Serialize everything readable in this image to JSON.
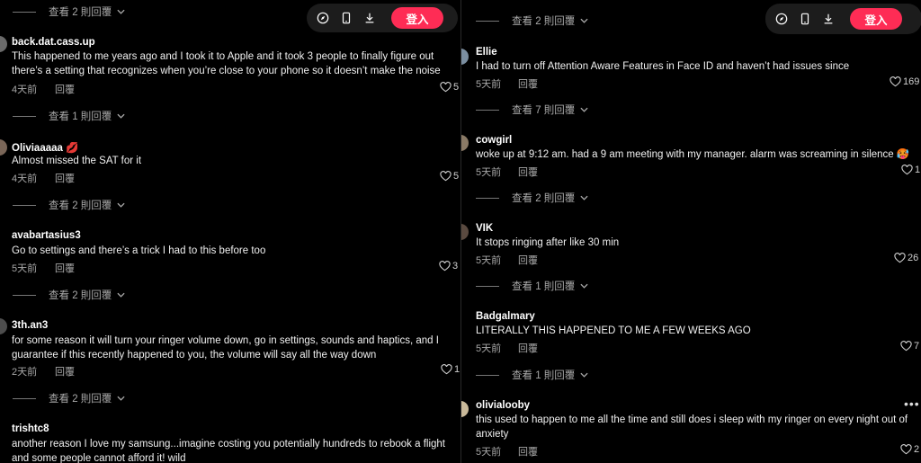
{
  "left": {
    "toolbar": {
      "login_label": "登入"
    },
    "top_view_more": "查看 2 則回覆",
    "comments": [
      {
        "user": "back.dat.cass.up",
        "lines": [
          "This happened to me years ago and I took it to Apple and it took 3 people to finally figure out",
          "there’s a setting that recognizes when you’re close to your phone so it doesn’t make the noise"
        ],
        "time": "4天前",
        "reply": "回覆",
        "likes": "5",
        "view_more": "查看 1 則回覆"
      },
      {
        "user": "Oliviaaaaa 💋",
        "lines": [
          "Almost missed the SAT for it"
        ],
        "time": "4天前",
        "reply": "回覆",
        "likes": "5",
        "view_more": "查看 2 則回覆"
      },
      {
        "user": "avabartasius3",
        "lines": [
          "Go to settings and there’s a trick I had to this before too"
        ],
        "time": "5天前",
        "reply": "回覆",
        "likes": "3",
        "view_more": "查看 2 則回覆"
      },
      {
        "user": "3th.an3",
        "lines": [
          "for some reason it will turn your ringer volume down, go in settings, sounds and haptics, and I",
          "guarantee if this recently happened to you, the volume will say all the way down"
        ],
        "time": "2天前",
        "reply": "回覆",
        "likes": "1",
        "view_more": "查看 2 則回覆"
      },
      {
        "user": "trishtc8",
        "lines": [
          "another reason I love my samsung...imagine costing you potentially hundreds to rebook a flight",
          "and some people cannot afford it! wild"
        ],
        "time": "",
        "reply": "",
        "likes": "",
        "view_more": ""
      }
    ]
  },
  "right": {
    "toolbar": {
      "login_label": "登入"
    },
    "top_view_more": "查看 2 則回覆",
    "comments": [
      {
        "user": "Ellie",
        "lines": [
          "I had to turn off Attention Aware Features in Face ID and haven’t had issues since"
        ],
        "time": "5天前",
        "reply": "回覆",
        "likes": "169",
        "view_more": "查看 7 則回覆"
      },
      {
        "user": "cowgirl",
        "lines": [
          "woke up at 9:12 am. had a 9 am meeting with my manager. alarm was screaming in silence 🥵"
        ],
        "time": "5天前",
        "reply": "回覆",
        "likes": "1",
        "view_more": "查看 2 則回覆"
      },
      {
        "user": "VIK",
        "lines": [
          "It stops ringing after like 30 min"
        ],
        "time": "5天前",
        "reply": "回覆",
        "likes": "26",
        "view_more": "查看 1 則回覆"
      },
      {
        "user": "Badgalmary",
        "lines": [
          "LITERALLY THIS HAPPENED TO ME A FEW WEEKS AGO"
        ],
        "time": "5天前",
        "reply": "回覆",
        "likes": "7",
        "view_more": "查看 1 則回覆"
      },
      {
        "user": "olivialooby",
        "lines": [
          "this used to happen to me all the time and still does i sleep with my ringer on every night out of",
          "anxiety"
        ],
        "time": "5天前",
        "reply": "回覆",
        "likes": "2",
        "view_more": ""
      }
    ]
  },
  "icons": {
    "compass": "compass-icon",
    "phone": "mobile-icon",
    "download": "download-icon",
    "heart": "heart-icon",
    "chevron": "chevron-down-icon",
    "more": "more-icon"
  },
  "colors": {
    "accent": "#fe2c55",
    "background": "#000000",
    "muted": "#a8a8a8"
  }
}
